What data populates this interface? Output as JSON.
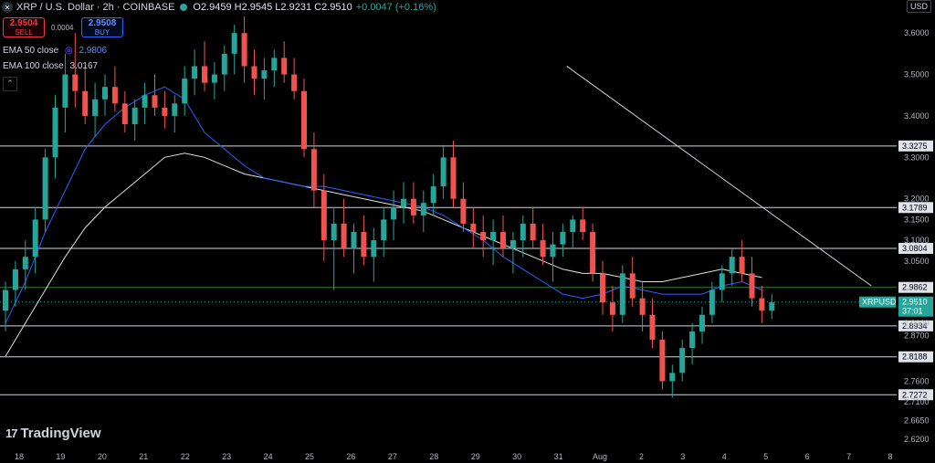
{
  "header": {
    "symbol_icon": "close-icon",
    "title": "XRP / U.S. Dollar · 2h · COINBASE",
    "ohlc": "O2.9459 H2.9545 L2.9231 C2.9510",
    "change": "+0.0047 (+0.16%)"
  },
  "trade": {
    "sell_price": "2.9504",
    "sell_label": "SELL",
    "spread": "0.0004",
    "buy_price": "2.9508",
    "buy_label": "BUY"
  },
  "indicators": [
    {
      "label": "EMA 50 close",
      "value": "2.9806",
      "color": "#2962ff"
    },
    {
      "label": "EMA 100 close",
      "value": "3.0167",
      "color": "#e0e0e0"
    }
  ],
  "currency": "USD",
  "logo": "TradingView",
  "colors": {
    "up": "#26a69a",
    "down": "#ef5350",
    "level": "#d1d4dc",
    "support_green": "#2e7d32",
    "ema50": "#2962ff",
    "ema100": "#e0e0e0"
  },
  "chart_data": {
    "type": "candlestick",
    "symbol": "XRPUSD",
    "interval": "2h",
    "ylim": [
      2.6,
      3.64
    ],
    "y_ticks": [
      3.6,
      3.5,
      3.4,
      3.3,
      3.2,
      3.15,
      3.1,
      3.05,
      2.9,
      2.87,
      2.76,
      2.71,
      2.665,
      2.62
    ],
    "y_tick_labels": [
      "3.6000",
      "3.5000",
      "3.4000",
      "3.3000",
      "3.2000",
      "3.1500",
      "3.1000",
      "3.0500",
      "2.9000",
      "2.8700",
      "2.7600",
      "2.7100",
      "2.6650",
      "2.6200"
    ],
    "x_labels": [
      "18",
      "19",
      "20",
      "21",
      "22",
      "23",
      "24",
      "25",
      "26",
      "27",
      "28",
      "29",
      "30",
      "31",
      "Aug",
      "2",
      "3",
      "4",
      "5",
      "6",
      "7",
      "8"
    ],
    "levels": [
      {
        "value": 3.3275,
        "label": "3.3275"
      },
      {
        "value": 3.1789,
        "label": "3.1789"
      },
      {
        "value": 3.0804,
        "label": "3.0804"
      },
      {
        "value": 2.8934,
        "label": "2.8934"
      },
      {
        "value": 2.8188,
        "label": "2.8188"
      },
      {
        "value": 2.7272,
        "label": "2.7272"
      }
    ],
    "support": {
      "value": 2.9862,
      "label": "2.9862"
    },
    "last_price": {
      "value": 2.951,
      "label": "2.9510",
      "countdown": "37:01",
      "symbol": "XRPUSD"
    },
    "trendline": {
      "from": {
        "x": 28.2,
        "y": 3.52
      },
      "to": {
        "x": 43.5,
        "y": 2.99
      }
    },
    "ema50_points": [
      [
        0,
        2.9
      ],
      [
        1,
        3.0
      ],
      [
        2,
        3.12
      ],
      [
        3,
        3.22
      ],
      [
        4,
        3.32
      ],
      [
        5,
        3.38
      ],
      [
        6,
        3.42
      ],
      [
        7,
        3.45
      ],
      [
        8,
        3.47
      ],
      [
        9,
        3.44
      ],
      [
        10,
        3.36
      ],
      [
        11,
        3.32
      ],
      [
        12,
        3.28
      ],
      [
        13,
        3.25
      ],
      [
        14,
        3.24
      ],
      [
        15,
        3.23
      ],
      [
        16,
        3.23
      ],
      [
        17,
        3.22
      ],
      [
        18,
        3.21
      ],
      [
        19,
        3.2
      ],
      [
        20,
        3.19
      ],
      [
        21,
        3.18
      ],
      [
        22,
        3.16
      ],
      [
        23,
        3.13
      ],
      [
        24,
        3.1
      ],
      [
        25,
        3.06
      ],
      [
        26,
        3.03
      ],
      [
        27,
        3.0
      ],
      [
        28,
        2.97
      ],
      [
        29,
        2.96
      ],
      [
        30,
        2.97
      ],
      [
        31,
        2.99
      ],
      [
        32,
        2.98
      ],
      [
        33,
        2.97
      ],
      [
        34,
        2.97
      ],
      [
        35,
        2.97
      ],
      [
        36,
        2.99
      ],
      [
        37,
        3.0
      ],
      [
        38,
        2.98
      ]
    ],
    "ema100_points": [
      [
        0,
        2.82
      ],
      [
        1,
        2.9
      ],
      [
        2,
        2.98
      ],
      [
        3,
        3.06
      ],
      [
        4,
        3.13
      ],
      [
        5,
        3.18
      ],
      [
        6,
        3.22
      ],
      [
        7,
        3.26
      ],
      [
        8,
        3.3
      ],
      [
        9,
        3.31
      ],
      [
        10,
        3.3
      ],
      [
        11,
        3.28
      ],
      [
        12,
        3.26
      ],
      [
        13,
        3.25
      ],
      [
        14,
        3.24
      ],
      [
        15,
        3.23
      ],
      [
        16,
        3.22
      ],
      [
        17,
        3.21
      ],
      [
        18,
        3.2
      ],
      [
        19,
        3.19
      ],
      [
        20,
        3.18
      ],
      [
        21,
        3.17
      ],
      [
        22,
        3.15
      ],
      [
        23,
        3.13
      ],
      [
        24,
        3.11
      ],
      [
        25,
        3.09
      ],
      [
        26,
        3.07
      ],
      [
        27,
        3.05
      ],
      [
        28,
        3.03
      ],
      [
        29,
        3.02
      ],
      [
        30,
        3.02
      ],
      [
        31,
        3.01
      ],
      [
        32,
        3.0
      ],
      [
        33,
        3.0
      ],
      [
        34,
        3.01
      ],
      [
        35,
        3.02
      ],
      [
        36,
        3.03
      ],
      [
        37,
        3.02
      ],
      [
        38,
        3.01
      ]
    ],
    "candles": [
      [
        2.93,
        3.0,
        2.88,
        2.98
      ],
      [
        2.98,
        3.05,
        2.94,
        3.03
      ],
      [
        3.03,
        3.1,
        2.98,
        3.06
      ],
      [
        3.06,
        3.18,
        3.02,
        3.15
      ],
      [
        3.15,
        3.32,
        3.12,
        3.3
      ],
      [
        3.3,
        3.45,
        3.25,
        3.42
      ],
      [
        3.42,
        3.55,
        3.36,
        3.5
      ],
      [
        3.5,
        3.6,
        3.42,
        3.46
      ],
      [
        3.46,
        3.52,
        3.38,
        3.4
      ],
      [
        3.4,
        3.48,
        3.35,
        3.44
      ],
      [
        3.44,
        3.5,
        3.4,
        3.47
      ],
      [
        3.47,
        3.52,
        3.41,
        3.43
      ],
      [
        3.43,
        3.46,
        3.36,
        3.38
      ],
      [
        3.38,
        3.44,
        3.34,
        3.42
      ],
      [
        3.42,
        3.48,
        3.38,
        3.45
      ],
      [
        3.45,
        3.5,
        3.4,
        3.42
      ],
      [
        3.42,
        3.46,
        3.37,
        3.4
      ],
      [
        3.4,
        3.45,
        3.36,
        3.43
      ],
      [
        3.43,
        3.52,
        3.4,
        3.49
      ],
      [
        3.49,
        3.56,
        3.45,
        3.52
      ],
      [
        3.52,
        3.58,
        3.46,
        3.48
      ],
      [
        3.48,
        3.53,
        3.44,
        3.5
      ],
      [
        3.5,
        3.57,
        3.46,
        3.55
      ],
      [
        3.55,
        3.62,
        3.5,
        3.6
      ],
      [
        3.6,
        3.64,
        3.48,
        3.52
      ],
      [
        3.52,
        3.56,
        3.45,
        3.49
      ],
      [
        3.49,
        3.54,
        3.44,
        3.51
      ],
      [
        3.51,
        3.56,
        3.47,
        3.54
      ],
      [
        3.54,
        3.58,
        3.48,
        3.5
      ],
      [
        3.5,
        3.54,
        3.44,
        3.46
      ],
      [
        3.46,
        3.49,
        3.3,
        3.32
      ],
      [
        3.32,
        3.36,
        3.18,
        3.22
      ],
      [
        3.22,
        3.26,
        3.05,
        3.1
      ],
      [
        3.1,
        3.18,
        2.98,
        3.14
      ],
      [
        3.14,
        3.2,
        3.06,
        3.08
      ],
      [
        3.08,
        3.14,
        3.02,
        3.12
      ],
      [
        3.12,
        3.16,
        3.04,
        3.06
      ],
      [
        3.06,
        3.13,
        3.0,
        3.1
      ],
      [
        3.1,
        3.18,
        3.06,
        3.15
      ],
      [
        3.15,
        3.22,
        3.1,
        3.18
      ],
      [
        3.18,
        3.24,
        3.14,
        3.2
      ],
      [
        3.2,
        3.24,
        3.14,
        3.16
      ],
      [
        3.16,
        3.22,
        3.12,
        3.19
      ],
      [
        3.19,
        3.26,
        3.16,
        3.23
      ],
      [
        3.23,
        3.33,
        3.2,
        3.3
      ],
      [
        3.3,
        3.34,
        3.18,
        3.2
      ],
      [
        3.2,
        3.24,
        3.12,
        3.14
      ],
      [
        3.14,
        3.18,
        3.08,
        3.12
      ],
      [
        3.12,
        3.16,
        3.06,
        3.1
      ],
      [
        3.1,
        3.15,
        3.04,
        3.12
      ],
      [
        3.12,
        3.16,
        3.06,
        3.08
      ],
      [
        3.08,
        3.12,
        3.02,
        3.1
      ],
      [
        3.1,
        3.16,
        3.06,
        3.14
      ],
      [
        3.14,
        3.18,
        3.08,
        3.1
      ],
      [
        3.1,
        3.14,
        3.04,
        3.06
      ],
      [
        3.06,
        3.12,
        3.0,
        3.09
      ],
      [
        3.09,
        3.14,
        3.06,
        3.12
      ],
      [
        3.12,
        3.16,
        3.08,
        3.15
      ],
      [
        3.15,
        3.18,
        3.1,
        3.12
      ],
      [
        3.12,
        3.14,
        3.0,
        3.02
      ],
      [
        3.02,
        3.05,
        2.92,
        2.95
      ],
      [
        2.95,
        2.99,
        2.88,
        2.92
      ],
      [
        2.92,
        3.04,
        2.9,
        3.02
      ],
      [
        3.02,
        3.06,
        2.94,
        2.96
      ],
      [
        2.96,
        3.0,
        2.88,
        2.92
      ],
      [
        2.92,
        2.96,
        2.84,
        2.86
      ],
      [
        2.86,
        2.88,
        2.74,
        2.76
      ],
      [
        2.76,
        2.8,
        2.72,
        2.78
      ],
      [
        2.78,
        2.86,
        2.76,
        2.84
      ],
      [
        2.84,
        2.9,
        2.8,
        2.88
      ],
      [
        2.88,
        2.94,
        2.85,
        2.92
      ],
      [
        2.92,
        3.0,
        2.9,
        2.98
      ],
      [
        2.98,
        3.04,
        2.95,
        3.02
      ],
      [
        3.02,
        3.08,
        2.99,
        3.06
      ],
      [
        3.06,
        3.1,
        3.0,
        3.02
      ],
      [
        3.02,
        3.06,
        2.94,
        2.96
      ],
      [
        2.96,
        2.99,
        2.9,
        2.93
      ],
      [
        2.93,
        2.97,
        2.91,
        2.95
      ]
    ]
  }
}
